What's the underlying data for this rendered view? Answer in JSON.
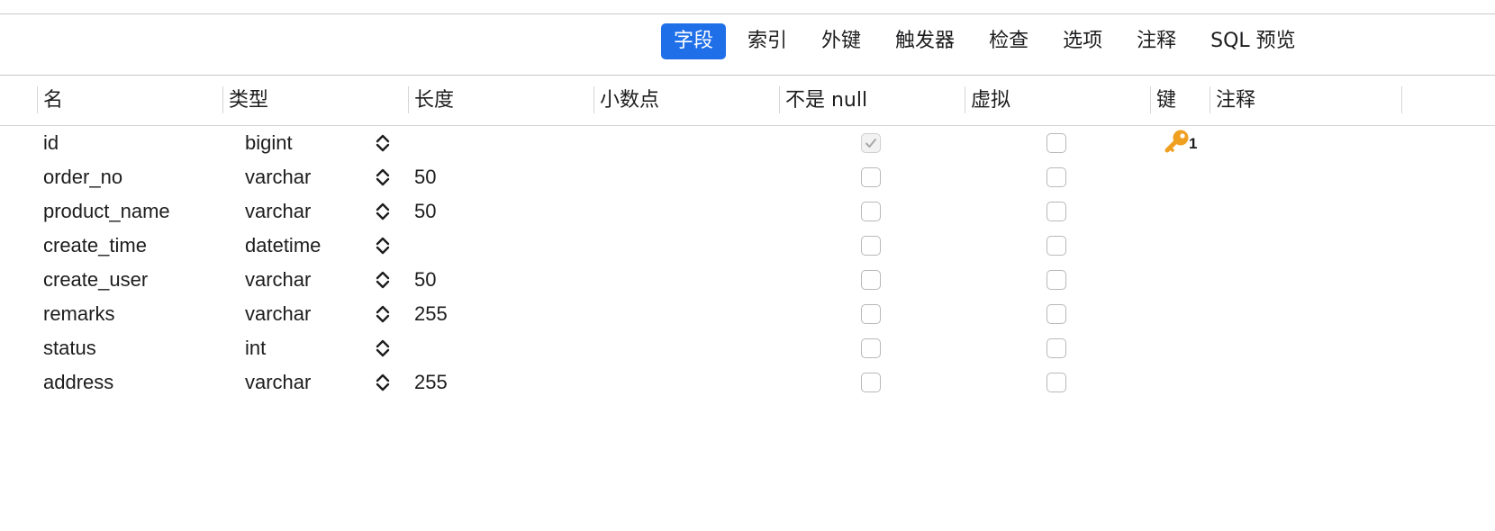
{
  "tabs": [
    {
      "label": "字段",
      "active": true
    },
    {
      "label": "索引",
      "active": false
    },
    {
      "label": "外键",
      "active": false
    },
    {
      "label": "触发器",
      "active": false
    },
    {
      "label": "检查",
      "active": false
    },
    {
      "label": "选项",
      "active": false
    },
    {
      "label": "注释",
      "active": false
    },
    {
      "label": "SQL 预览",
      "active": false
    }
  ],
  "columns": {
    "name": "名",
    "type": "类型",
    "length": "长度",
    "decimals": "小数点",
    "not_null": "不是 null",
    "virtual": "虚拟",
    "key": "键",
    "comment": "注释"
  },
  "rows": [
    {
      "name": "id",
      "type": "bigint",
      "length": "",
      "not_null": true,
      "virtual": false,
      "key": "1"
    },
    {
      "name": "order_no",
      "type": "varchar",
      "length": "50",
      "not_null": false,
      "virtual": false,
      "key": ""
    },
    {
      "name": "product_name",
      "type": "varchar",
      "length": "50",
      "not_null": false,
      "virtual": false,
      "key": ""
    },
    {
      "name": "create_time",
      "type": "datetime",
      "length": "",
      "not_null": false,
      "virtual": false,
      "key": ""
    },
    {
      "name": "create_user",
      "type": "varchar",
      "length": "50",
      "not_null": false,
      "virtual": false,
      "key": ""
    },
    {
      "name": "remarks",
      "type": "varchar",
      "length": "255",
      "not_null": false,
      "virtual": false,
      "key": ""
    },
    {
      "name": "status",
      "type": "int",
      "length": "",
      "not_null": false,
      "virtual": false,
      "key": ""
    },
    {
      "name": "address",
      "type": "varchar",
      "length": "255",
      "not_null": false,
      "virtual": false,
      "key": ""
    }
  ],
  "colors": {
    "active_tab": "#1f6fe8",
    "key_icon": "#f0a020"
  },
  "icons": {
    "type_stepper": "chevron-up-down-icon",
    "primary_key": "key-icon"
  }
}
